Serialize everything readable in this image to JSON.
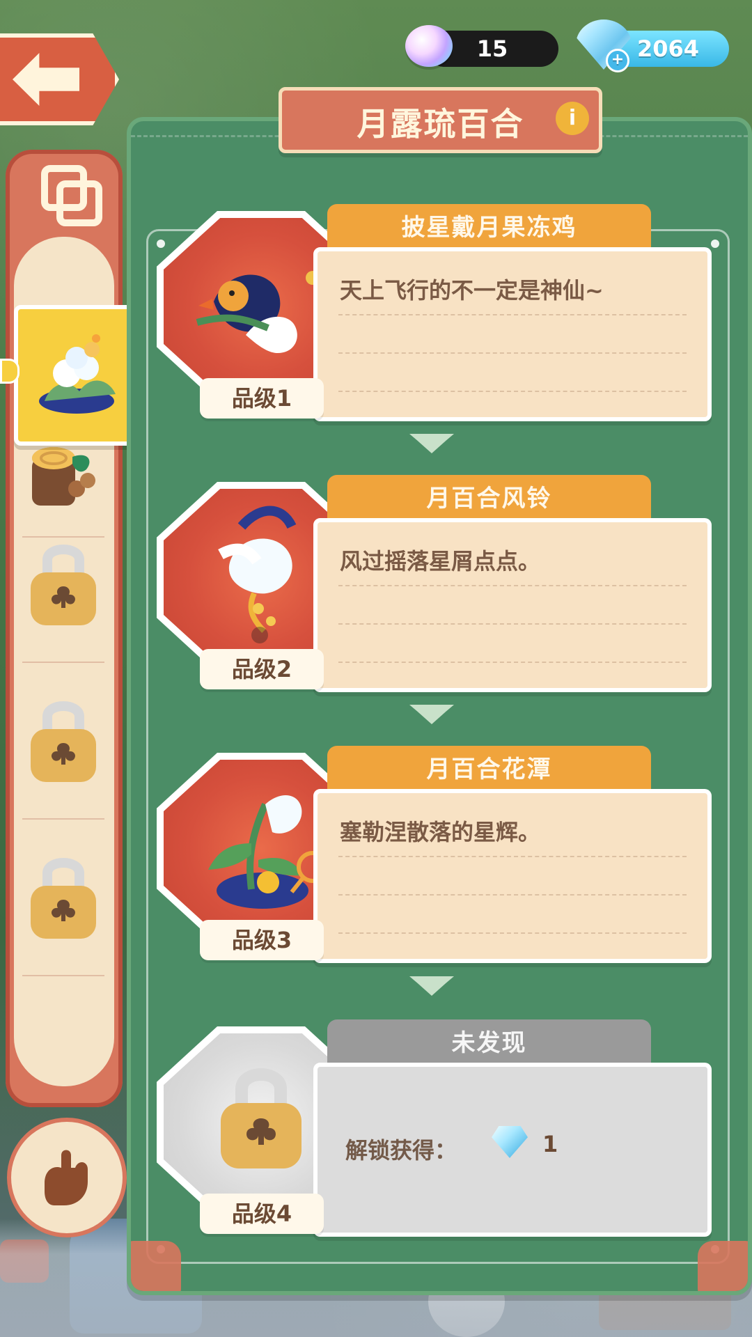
{
  "resources": {
    "cotton": {
      "value": "15",
      "icon": "rainbow-cotton-icon"
    },
    "gems": {
      "value": "2064",
      "icon": "diamond-icon",
      "plus_label": "+"
    }
  },
  "title": "月露琉百合",
  "info_label": "i",
  "entries": [
    {
      "name": "披星戴月果冻鸡",
      "description": "天上飞行的不一定是神仙~",
      "level": "品级1"
    },
    {
      "name": "月百合风铃",
      "description": "风过摇落星屑点点。",
      "level": "品级2"
    },
    {
      "name": "月百合花潭",
      "description": "塞勒涅散落的星辉。",
      "level": "品级3"
    },
    {
      "name": "未发现",
      "unlock_label": "解锁获得：",
      "reward_value": "1",
      "level": "品级4"
    }
  ],
  "colors": {
    "accent": "#d8765d",
    "panel": "#4b8d66",
    "header": "#f0a43c",
    "gray_header": "#9a9a9a"
  }
}
